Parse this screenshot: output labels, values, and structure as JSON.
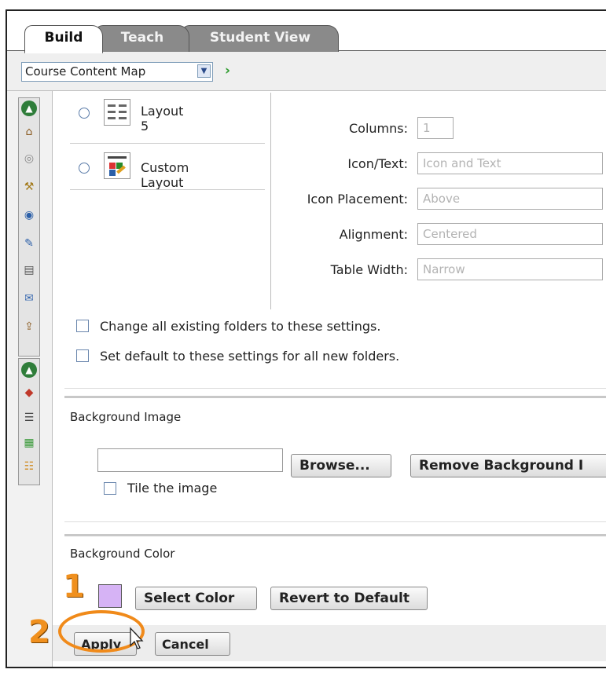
{
  "tabs": [
    {
      "label": "Build",
      "active": true
    },
    {
      "label": "Teach",
      "active": false
    },
    {
      "label": "Student View",
      "active": false
    }
  ],
  "coursemap": {
    "selected": "Course Content Map",
    "go_icon": "green-chevron-right"
  },
  "layouts": [
    {
      "label": "Layout 5",
      "icon": "layout-grid-icon"
    },
    {
      "label": "Custom Layout",
      "icon": "custom-layout-icon"
    }
  ],
  "settings": {
    "columns_label": "Columns:",
    "columns_value": "1",
    "icontext_label": "Icon/Text:",
    "icontext_value": "Icon and Text",
    "placement_label": "Icon Placement:",
    "placement_value": "Above",
    "alignment_label": "Alignment:",
    "alignment_value": "Centered",
    "width_label": "Table Width:",
    "width_value": "Narrow"
  },
  "checkboxes": {
    "change_all": "Change all existing folders to these settings.",
    "set_default": "Set default to these settings for all new folders."
  },
  "background_image": {
    "title": "Background Image",
    "path_value": "",
    "browse_label": "Browse...",
    "remove_label": "Remove Background I",
    "tile_label": "Tile the image"
  },
  "background_color": {
    "title": "Background Color",
    "swatch_color": "#d6b3f5",
    "select_label": "Select Color",
    "revert_label": "Revert to Default"
  },
  "actions": {
    "apply_label": "Apply",
    "cancel_label": "Cancel"
  },
  "annotations": {
    "step1": "1",
    "step2": "2",
    "highlight_color": "#f08a1a"
  }
}
